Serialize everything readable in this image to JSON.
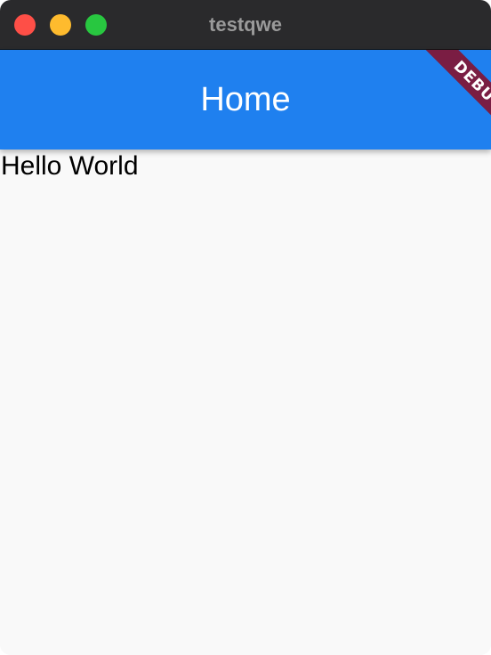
{
  "window": {
    "title": "testqwe",
    "controls": {
      "close": {
        "color": "#fe4f47"
      },
      "minimize": {
        "color": "#febb2e"
      },
      "zoom": {
        "color": "#28c740"
      }
    }
  },
  "appbar": {
    "title": "Home",
    "color": "#1f80ef"
  },
  "debug_banner": {
    "label": "DEBUG",
    "color": "#7a1d43"
  },
  "content": {
    "text": "Hello World"
  }
}
